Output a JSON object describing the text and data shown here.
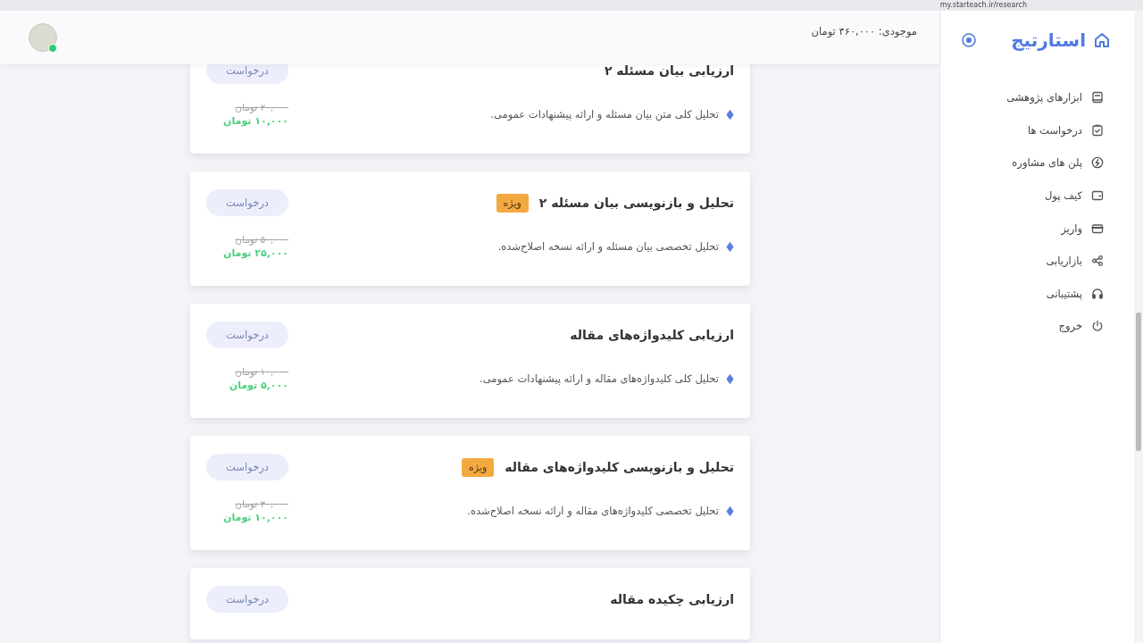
{
  "browser": {
    "url": "my.starteach.ir/research"
  },
  "sidebar": {
    "brand": "استارتیج",
    "items": [
      {
        "label": "ابزارهای پژوهشی",
        "kind": "book"
      },
      {
        "label": "درخواست ها",
        "kind": "clipboard"
      },
      {
        "label": "پلن های مشاوره",
        "kind": "bolt"
      },
      {
        "label": "کیف پول",
        "kind": "wallet"
      },
      {
        "label": "واریز",
        "kind": "card"
      },
      {
        "label": "بازاریابی",
        "kind": "share"
      },
      {
        "label": "پشتیبانی",
        "kind": "headphones"
      },
      {
        "label": "خروج",
        "kind": "power"
      }
    ]
  },
  "header": {
    "balance": "موجودی: ۴۶۰,۰۰۰ تومان",
    "user_online": true
  },
  "services": [
    {
      "title": "ارزیابی بیان مسئله ۲",
      "description": "تحلیل کلی متن بیان مسئله و ارائه پیشنهادات عمومی.",
      "old_price": "۲۰,۰۰۰ تومان",
      "price": "۱۰,۰۰۰ تومان",
      "button": "درخواست"
    },
    {
      "title": "تحلیل و بازنویسی بیان مسئله ۲",
      "badge": "ویژه",
      "description": "تحلیل تخصصی بیان مسئله و ارائه نسخه اصلاح‌شده.",
      "old_price": "۵۰,۰۰۰ تومان",
      "price": "۲۵,۰۰۰ تومان",
      "button": "درخواست"
    },
    {
      "title": "ارزیابی کلیدواژه‌های مقاله",
      "description": "تحلیل کلی کلیدواژه‌های مقاله و ارائه پیشنهادات عمومی.",
      "old_price": "۱۰,۰۰۰ تومان",
      "price": "۵,۰۰۰ تومان",
      "button": "درخواست"
    },
    {
      "title": "تحلیل و بازنویسی کلیدواژه‌های مقاله",
      "badge": "ویژه",
      "description": "تحلیل تخصصی کلیدواژه‌های مقاله و ارائه نسخه اصلاح‌شده.",
      "old_price": "۳۰,۰۰۰ تومان",
      "price": "۱۰,۰۰۰ تومان",
      "button": "درخواست"
    },
    {
      "title": "ارزیابی چکیده مقاله",
      "button": "درخواست"
    }
  ]
}
